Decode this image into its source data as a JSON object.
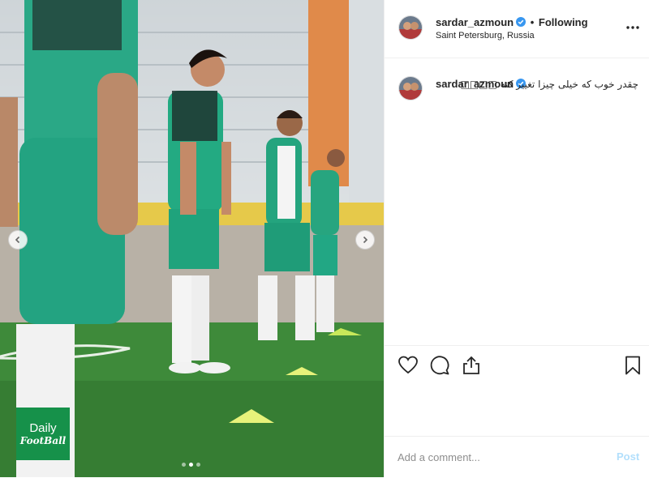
{
  "post": {
    "username": "sardar_azmoun",
    "verified": true,
    "separator": "•",
    "follow_state": "Following",
    "location": "Saint Petersburg, Russia",
    "caption": "چقدر خوب که خیلی چیزا تغییر کنه □□□□",
    "comment_placeholder": "Add a comment...",
    "post_label": "Post"
  },
  "carousel": {
    "total_slides": 3,
    "active_slide": 2
  },
  "watermark": {
    "line1": "Daily",
    "line2": "FootBall"
  },
  "icons": {
    "verified": "verified-badge-icon",
    "more": "more-options-icon",
    "like": "heart-icon",
    "comment": "comment-bubble-icon",
    "share": "share-upload-icon",
    "save": "bookmark-icon",
    "prev": "chevron-left-icon",
    "next": "chevron-right-icon"
  },
  "colors": {
    "verified_blue": "#3897f0",
    "post_disabled": "#b2dffc",
    "kit_green": "#22a784",
    "pitch_green": "#3e8a3a"
  }
}
